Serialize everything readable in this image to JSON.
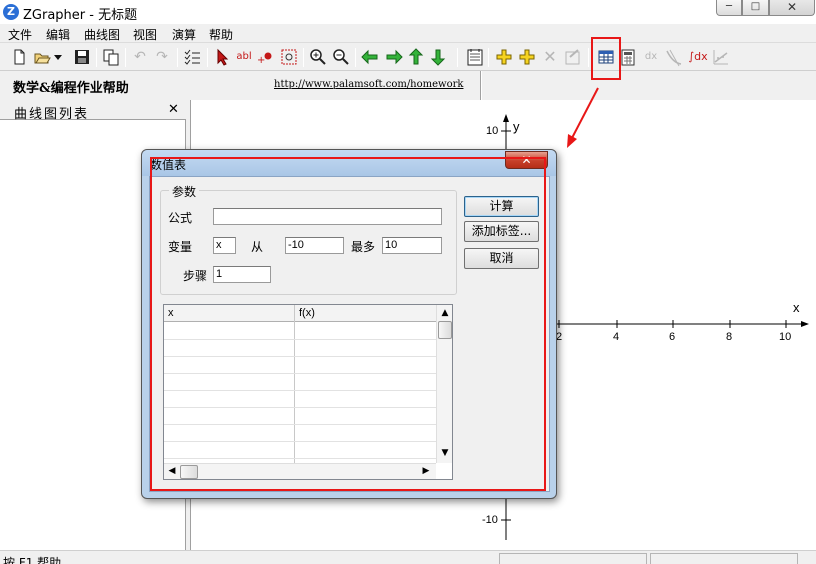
{
  "window": {
    "app_icon": "Z",
    "title": "ZGrapher - 无标题",
    "minimize_icon": "─",
    "maximize_icon": "□",
    "close_icon": "✕"
  },
  "menu": [
    "文件",
    "编辑",
    "曲线图",
    "视图",
    "演算",
    "帮助"
  ],
  "toolbar": {
    "icons": [
      "new-file",
      "open-folder",
      "dropdown",
      "save",
      "copy",
      "undo",
      "redo",
      "curve-list",
      "select-pointer",
      "insert-text",
      "add-point",
      "zoom-region",
      "zoom-in",
      "zoom-out",
      "arrow-left",
      "arrow-right",
      "arrow-up",
      "arrow-down",
      "formula-sheet",
      "add-curve",
      "add-item",
      "delete",
      "properties",
      "table-of-values",
      "calculator",
      "derivative",
      "tangent",
      "integral",
      "regression"
    ],
    "text_buttons": {
      "insert_text": "abl",
      "derivative": "dx",
      "integral": "∫dx"
    },
    "highlight_color": "#e81717"
  },
  "helpbar": {
    "title": "数学&编程作业帮助",
    "link": "http://www.palamsoft.com/homework"
  },
  "curve_panel": {
    "title": "曲线图列表",
    "close": "✕"
  },
  "graph": {
    "x_label": "x",
    "y_label": "y",
    "x_ticks": [
      "2",
      "4",
      "6",
      "8",
      "10"
    ],
    "y_top_label": "10",
    "y_bottom_label": "-10"
  },
  "status": {
    "text": "按 F1 帮助"
  },
  "dialog": {
    "title": "数值表",
    "close_icon": "✕",
    "params_group": "参数",
    "formula_label": "公式",
    "formula_value": "",
    "variable_label": "变量",
    "variable_value": "x",
    "from_label": "从",
    "from_value": "-10",
    "to_label": "最多",
    "to_value": "10",
    "step_label": "步骤",
    "step_value": "1",
    "buttons": {
      "calculate": "计算",
      "add_label": "添加标签...",
      "cancel": "取消"
    },
    "table": {
      "columns": [
        "x",
        "f(x)"
      ],
      "rows": []
    },
    "highlight_color": "#e81717"
  }
}
